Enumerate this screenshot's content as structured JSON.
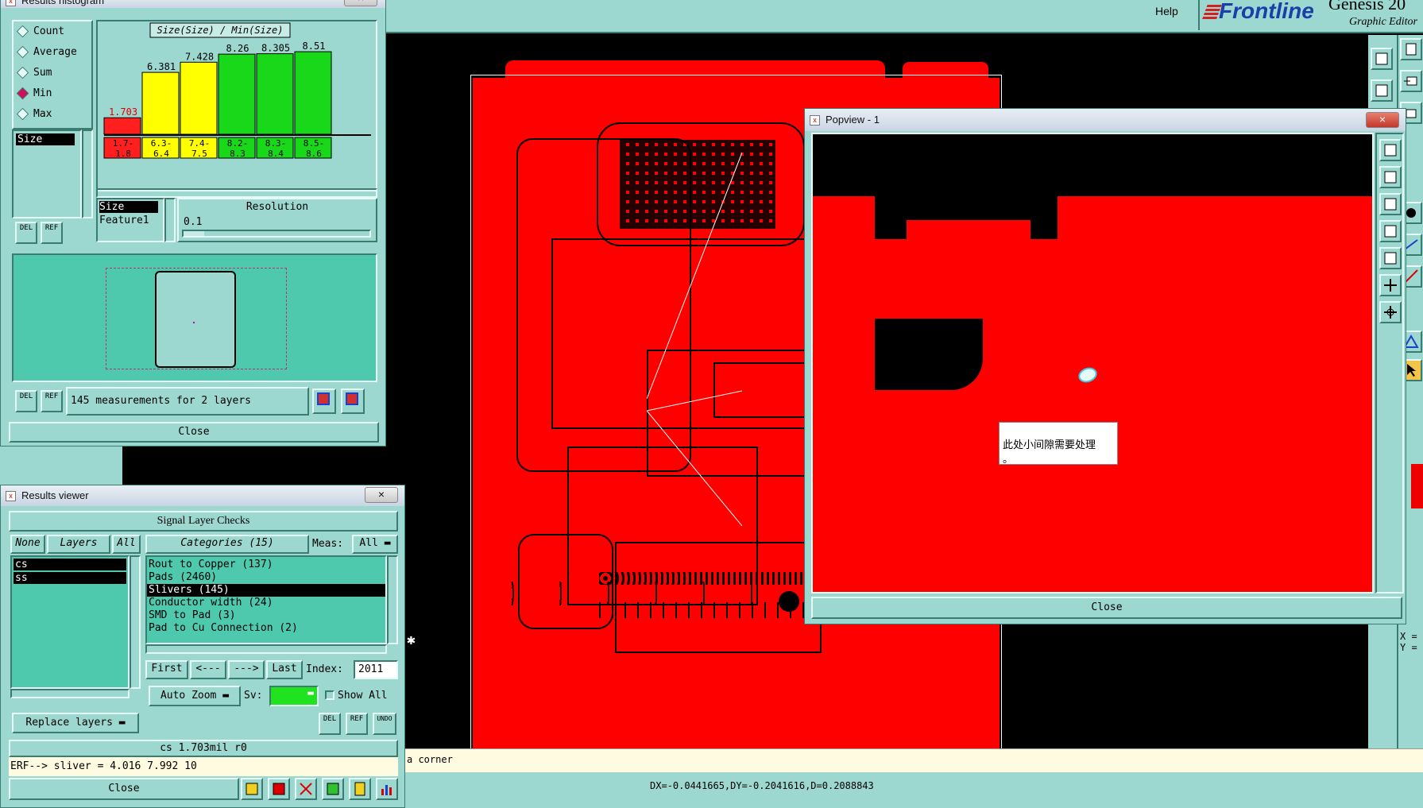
{
  "app": {
    "help_label": "Help",
    "brand": "Frontline",
    "product": "Genesis 20",
    "subtitle": "Graphic Editor",
    "hint_text": "a corner",
    "coords_text": "DX=-0.0441665,DY=-0.2041616,D=0.2088843",
    "xy_labels": [
      "X =",
      "Y ="
    ]
  },
  "histogram": {
    "title": "Results histogram",
    "radio_options": [
      {
        "label": "Count",
        "selected": false
      },
      {
        "label": "Average",
        "selected": false
      },
      {
        "label": "Sum",
        "selected": false
      },
      {
        "label": "Min",
        "selected": true
      },
      {
        "label": "Max",
        "selected": false
      }
    ],
    "list_items": [
      "Size"
    ],
    "chart_title": "Size(Size) / Min(Size)",
    "attr_list": [
      "Size",
      "Feature1"
    ],
    "resolution_label": "Resolution",
    "resolution_value": "0.1",
    "del_label": "DEL",
    "ref_label": "REF",
    "status_text": "145 measurements for 2 layers",
    "close_label": "Close"
  },
  "chart_data": {
    "type": "bar",
    "title": "Size(Size) / Min(Size)",
    "categories": [
      "1.7-1.8",
      "6.3-6.4",
      "7.4-7.5",
      "8.2-8.3",
      "8.3-8.4",
      "8.5-8.6"
    ],
    "value_labels": [
      "1.703",
      "6.381",
      "7.428",
      "8.26",
      "8.305",
      "8.51"
    ],
    "values": [
      1.703,
      6.381,
      7.428,
      8.26,
      8.305,
      8.51
    ],
    "ylim": [
      0,
      9.5
    ],
    "colors": [
      "#ff1f1f",
      "#ffff00",
      "#ffff00",
      "#19d719",
      "#19d719",
      "#19d719"
    ]
  },
  "viewer": {
    "title": "Results viewer",
    "header": "Signal Layer Checks",
    "none_label": "None",
    "layers_label": "Layers",
    "all_label": "All",
    "categories_label": "Categories (15)",
    "meas_label": "Meas:",
    "meas_value": "All",
    "layers": [
      "cs",
      "ss"
    ],
    "categories": [
      {
        "label": "Rout to Copper (137)",
        "selected": false
      },
      {
        "label": "Pads (2460)",
        "selected": false
      },
      {
        "label": "Slivers (145)",
        "selected": true
      },
      {
        "label": "Conductor width (24)",
        "selected": false
      },
      {
        "label": "SMD to Pad (3)",
        "selected": false
      },
      {
        "label": "Pad to Cu Connection (2)",
        "selected": false
      }
    ],
    "first_label": "First",
    "prev_label": "<---",
    "next_label": "--->",
    "last_label": "Last",
    "index_label": "Index:",
    "index_value": "2011",
    "zoom_label": "Auto Zoom",
    "sv_label": "Sv:",
    "show_all_label": "Show All",
    "replace_label": "Replace layers",
    "del_label": "DEL",
    "ref_label": "REF",
    "undo_label": "UNDO",
    "status_line": "cs 1.703mil  r0",
    "erf_line": "ERF--> sliver = 4.016 7.992 10",
    "close_label": "Close"
  },
  "popview": {
    "title": "Popview - 1",
    "note": "此处小间隙需要处理\n。",
    "close_label": "Close"
  }
}
